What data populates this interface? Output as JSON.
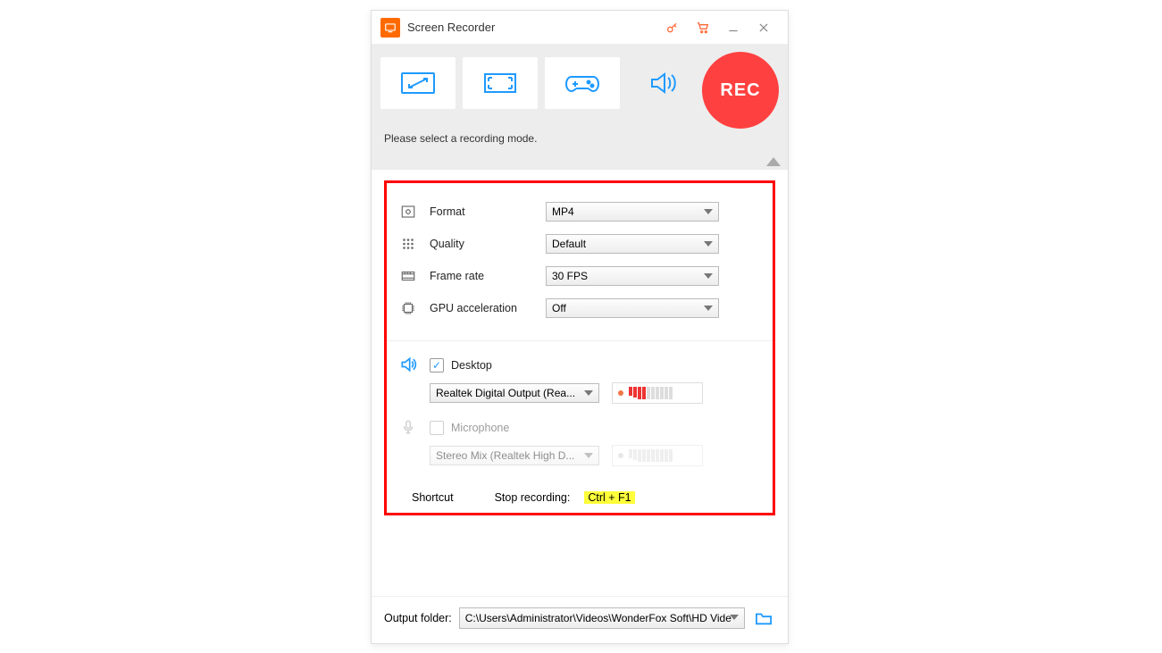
{
  "titlebar": {
    "title": "Screen Recorder"
  },
  "modebar": {
    "hint": "Please select a recording mode.",
    "rec_label": "REC"
  },
  "settings": {
    "format": {
      "label": "Format",
      "value": "MP4"
    },
    "quality": {
      "label": "Quality",
      "value": "Default"
    },
    "framerate": {
      "label": "Frame rate",
      "value": "30 FPS"
    },
    "gpu": {
      "label": "GPU acceleration",
      "value": "Off"
    }
  },
  "audio": {
    "desktop": {
      "label": "Desktop",
      "device": "Realtek Digital Output (Rea...",
      "checked": true,
      "level_bars_on": 4
    },
    "microphone": {
      "label": "Microphone",
      "device": "Stereo Mix (Realtek High D...",
      "checked": false,
      "level_bars_on": 0
    }
  },
  "shortcut": {
    "label": "Shortcut",
    "stop_label": "Stop recording:",
    "stop_key": "Ctrl + F1"
  },
  "footer": {
    "label": "Output folder:",
    "path": "C:\\Users\\Administrator\\Videos\\WonderFox Soft\\HD Vide"
  }
}
